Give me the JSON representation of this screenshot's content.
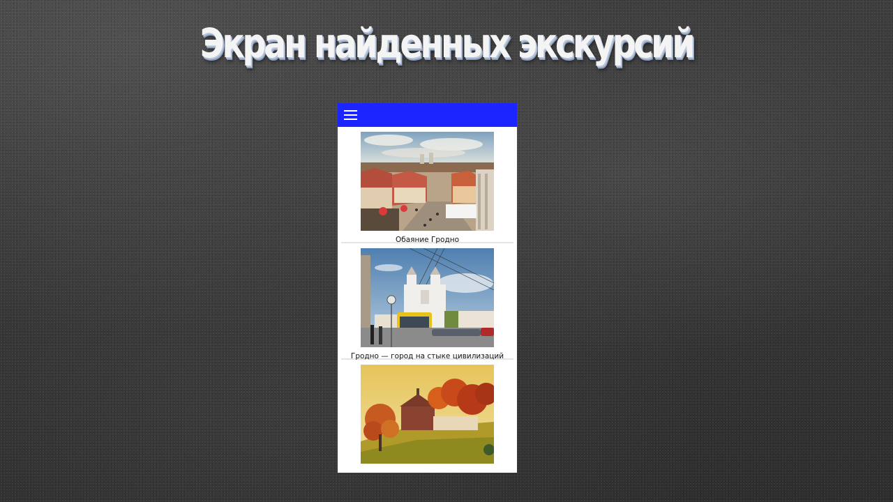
{
  "slide": {
    "title": "Экран найденных экскурсий"
  },
  "app": {
    "appbar_color": "#1c25ff",
    "menu_icon": "hamburger-menu-icon"
  },
  "tours": [
    {
      "title": "Обаяние Гродно",
      "image": "old-town-rooftops-photo"
    },
    {
      "title": "Гродно — город на стыке цивилизаций",
      "image": "cathedral-trolleybus-photo"
    },
    {
      "title": "",
      "image": "autumn-church-photo"
    }
  ]
}
